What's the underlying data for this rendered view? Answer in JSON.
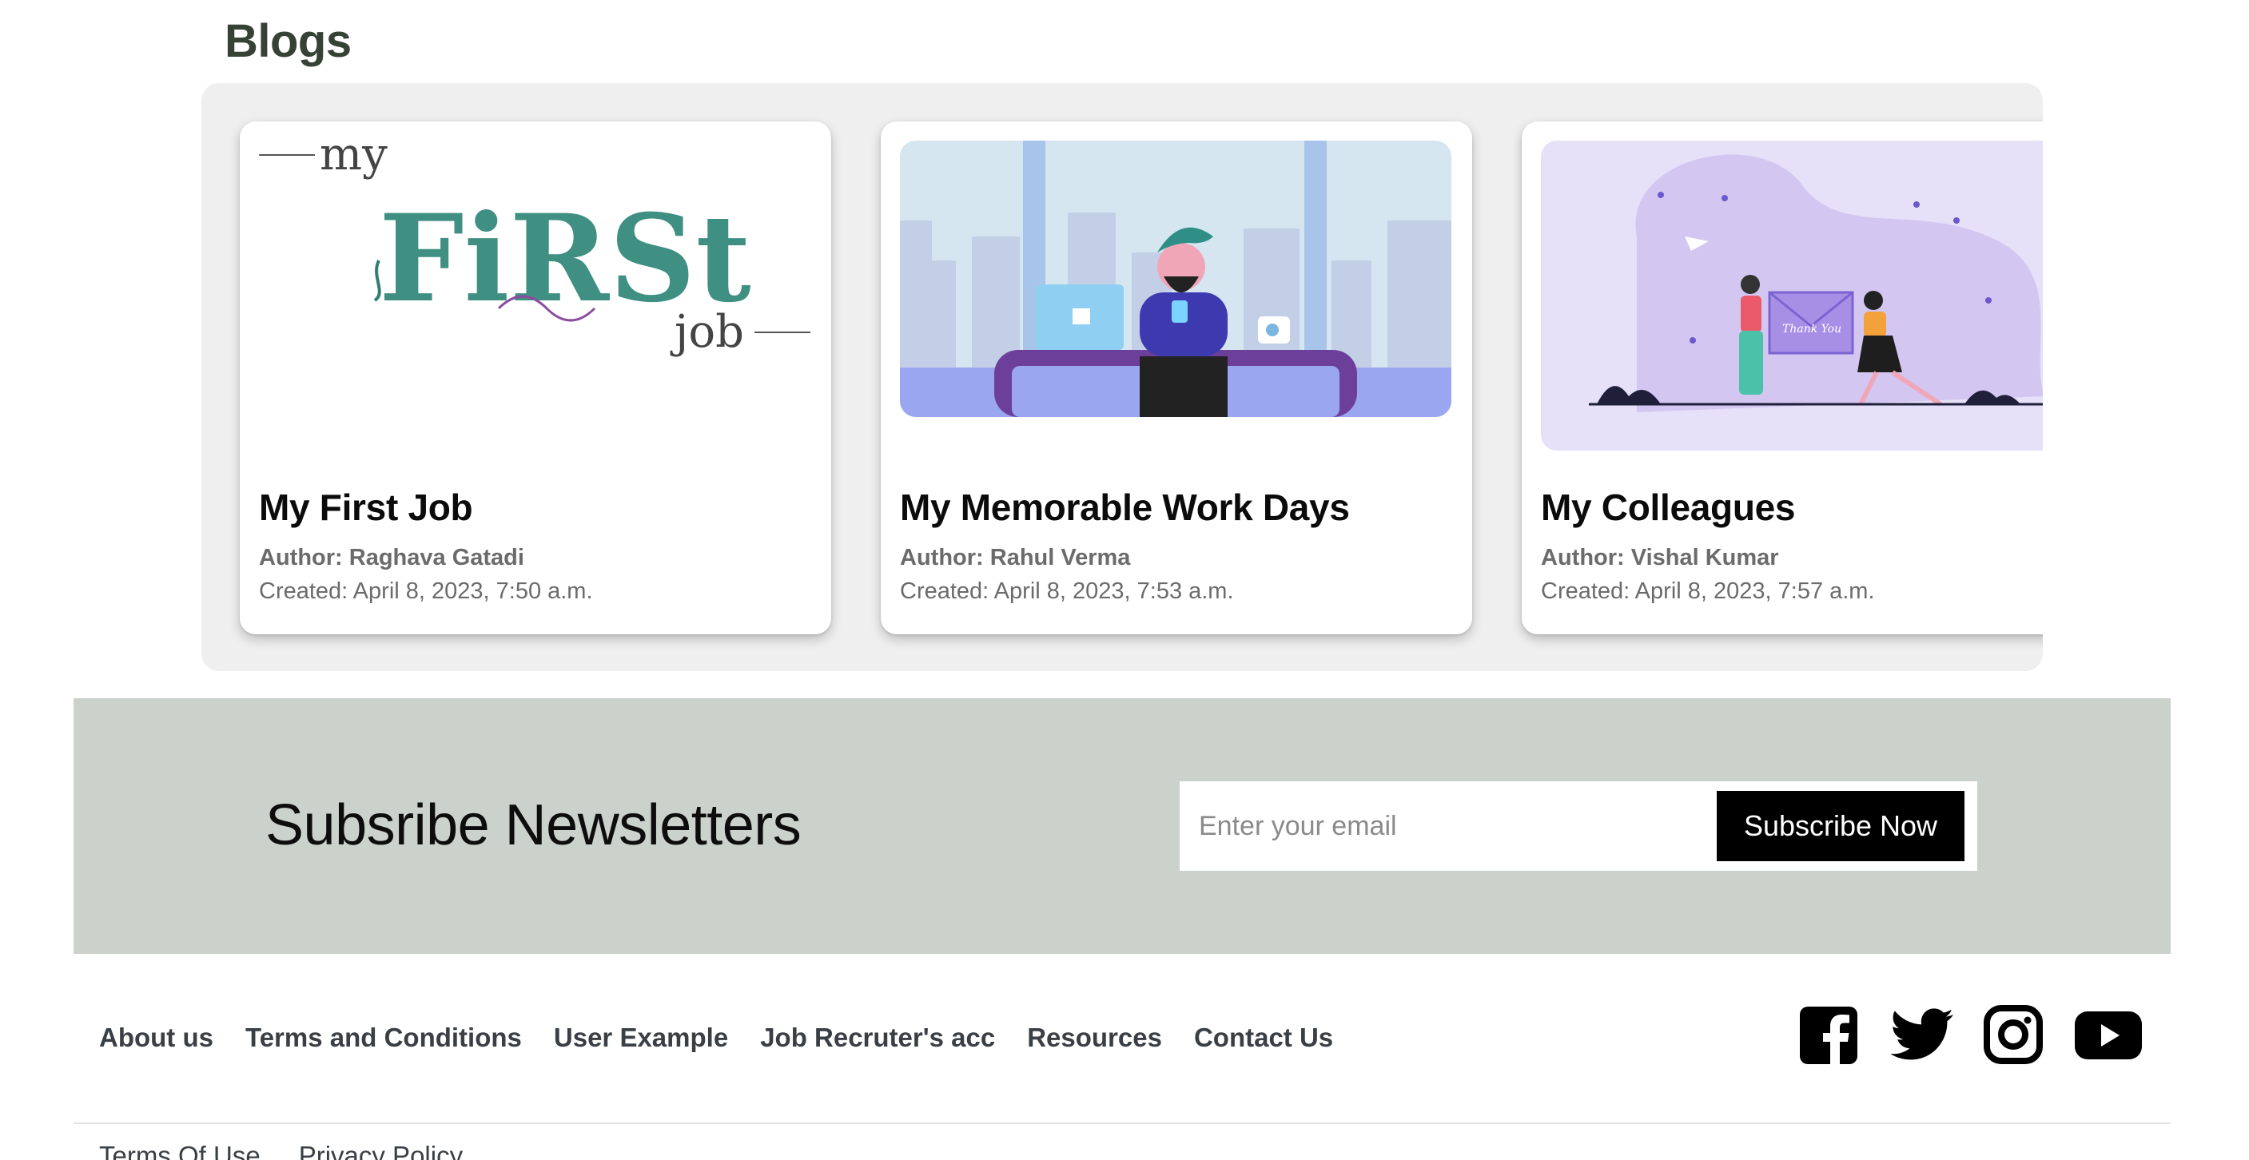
{
  "blogs": {
    "heading": "Blogs",
    "cards": [
      {
        "title": "My First Job",
        "author_label": "Author:",
        "author": "Raghava Gatadi",
        "created": "Created: April 8, 2023, 7:50 a.m.",
        "image_text": {
          "top": "my",
          "main": "FiRSt",
          "bottom": "job"
        }
      },
      {
        "title": "My Memorable Work Days",
        "author_label": "Author:",
        "author": "Rahul Verma",
        "created": "Created: April 8, 2023, 7:53 a.m."
      },
      {
        "title": "My Colleagues",
        "author_label": "Author:",
        "author": "Vishal Kumar",
        "created": "Created: April 8, 2023, 7:57 a.m.",
        "image_text": {
          "envelope": "Thank You"
        }
      }
    ]
  },
  "newsletter": {
    "title": "Subsribe Newsletters",
    "email_placeholder": "Enter your email",
    "button_label": "Subscribe Now"
  },
  "footer": {
    "links": [
      "About us",
      "Terms and Conditions",
      "User Example",
      "Job Recruter's acc",
      "Resources",
      "Contact Us"
    ],
    "social": [
      "facebook-icon",
      "twitter-icon",
      "instagram-icon",
      "youtube-icon"
    ],
    "legal": [
      "Terms Of Use",
      "Privacy Policy"
    ]
  },
  "colors": {
    "panel_bg": "#efefef",
    "newsletter_bg": "#cbd2cb",
    "heading": "#374236",
    "button_bg": "#000000"
  }
}
